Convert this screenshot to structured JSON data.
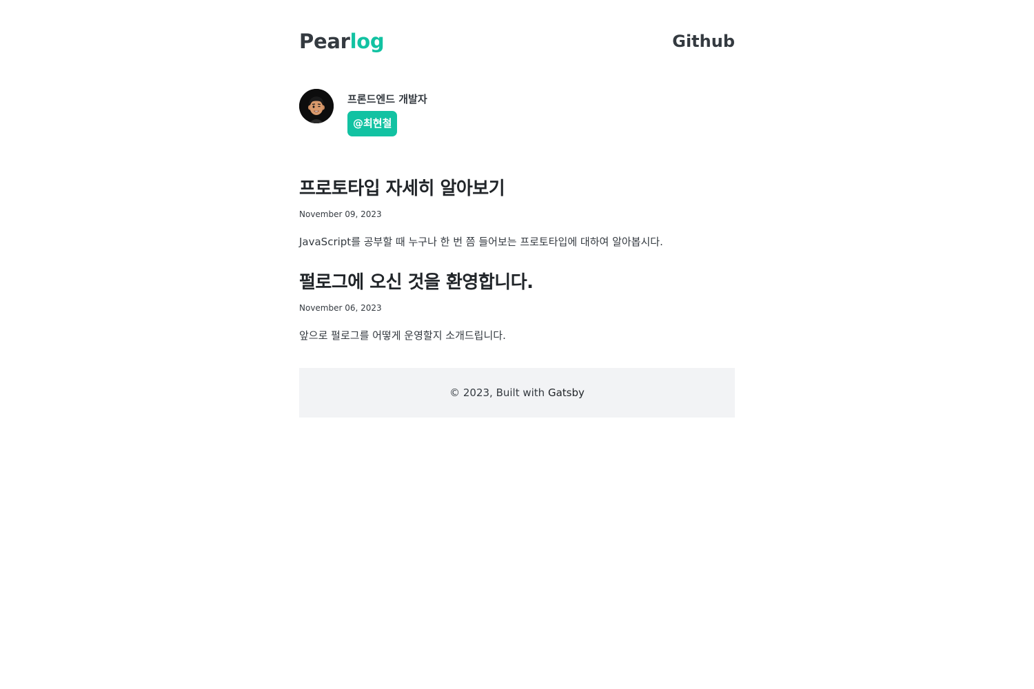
{
  "header": {
    "logo_part1": "Pear",
    "logo_part2": "log",
    "github_label": "Github"
  },
  "bio": {
    "role": "프론드엔드 개발자",
    "name_badge": "@최현철",
    "avatar_icon": "memoji-avatar-icon"
  },
  "posts": [
    {
      "title": "프로토타입 자세히 알아보기",
      "date": "November 09, 2023",
      "description": "JavaScript를 공부할 때 누구나 한 번 쯤 들어보는 프로토타입에 대하여 알아봅시다."
    },
    {
      "title": "펄로그에 오신 것을 환영합니다.",
      "date": "November 06, 2023",
      "description": "앞으로 펄로그를 어떻게 운영할지 소개드립니다."
    }
  ],
  "footer": {
    "copyright_text": "© 2023, Built with ",
    "gatsby_link": "Gatsby"
  },
  "colors": {
    "accent": "#12c2a2",
    "text_dark": "#343a40",
    "footer_bg": "#f2f3f5"
  }
}
